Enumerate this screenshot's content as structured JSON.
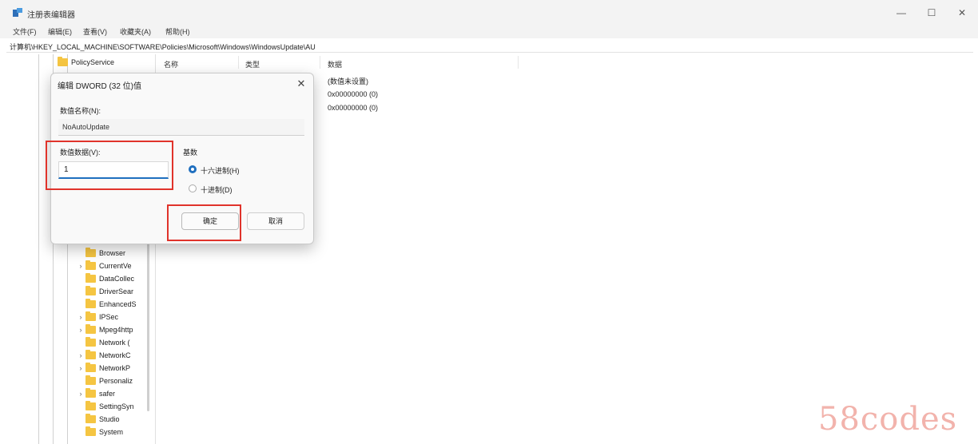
{
  "window": {
    "title": "注册表编辑器",
    "minimize_icon": "—",
    "maximize_icon": "☐",
    "close_icon": "✕"
  },
  "menu": [
    "文件(F)",
    "编辑(E)",
    "查看(V)",
    "收藏夹(A)",
    "帮助(H)"
  ],
  "address": "计算机\\HKEY_LOCAL_MACHINE\\SOFTWARE\\Policies\\Microsoft\\Windows\\WindowsUpdate\\AU",
  "tree": {
    "top_item": "PolicyService",
    "items": [
      {
        "label": "Browser",
        "expandable": false
      },
      {
        "label": "CurrentVe",
        "expandable": true
      },
      {
        "label": "DataCollec",
        "expandable": false
      },
      {
        "label": "DriverSear",
        "expandable": false
      },
      {
        "label": "EnhancedS",
        "expandable": false
      },
      {
        "label": "IPSec",
        "expandable": true
      },
      {
        "label": "Mpeg4http",
        "expandable": true
      },
      {
        "label": "Network (",
        "expandable": false
      },
      {
        "label": "NetworkC",
        "expandable": true
      },
      {
        "label": "NetworkP",
        "expandable": true
      },
      {
        "label": "Personaliz",
        "expandable": false
      },
      {
        "label": "safer",
        "expandable": true
      },
      {
        "label": "SettingSyn",
        "expandable": false
      },
      {
        "label": "Studio",
        "expandable": false
      },
      {
        "label": "System",
        "expandable": false
      }
    ]
  },
  "list": {
    "columns": [
      "名称",
      "类型",
      "数据"
    ],
    "rows": [
      {
        "data": "(数值未设置)"
      },
      {
        "data": "0x00000000 (0)"
      },
      {
        "data": "0x00000000 (0)"
      }
    ]
  },
  "dialog": {
    "title": "编辑 DWORD (32 位)值",
    "close_icon": "✕",
    "name_label": "数值名称(N):",
    "name_value": "NoAutoUpdate",
    "value_label": "数值数据(V):",
    "value": "1",
    "base_label": "基数",
    "hex_label": "十六进制(H)",
    "dec_label": "十进制(D)",
    "selected_base": "hex",
    "ok_label": "确定",
    "cancel_label": "取消"
  },
  "highlight_color": "#e0332b",
  "accent_color": "#1f6fbf",
  "watermark": "58codes"
}
